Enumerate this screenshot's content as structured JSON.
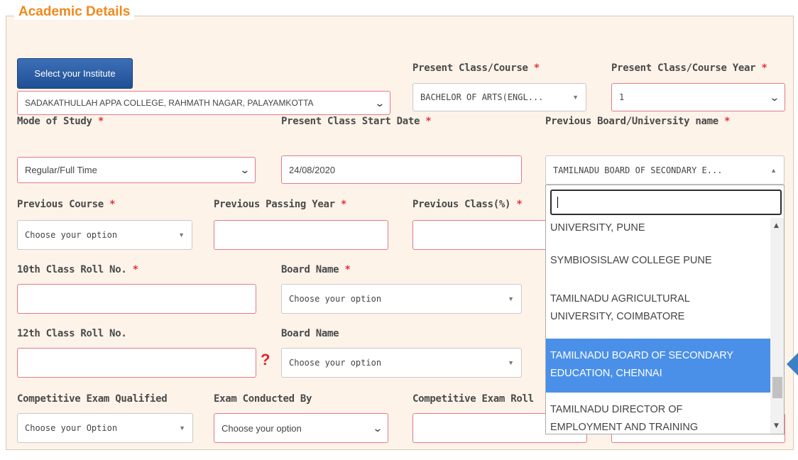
{
  "section": {
    "title": "Academic Details"
  },
  "institute": {
    "button_label": "Select your Institute",
    "value": "SADAKATHULLAH APPA COLLEGE, RAHMATH NAGAR, PALAYAMKOTTA"
  },
  "present_class": {
    "label": "Present Class/Course",
    "value": "BACHELOR OF ARTS(ENGL..."
  },
  "present_year": {
    "label": "Present Class/Course Year",
    "value": "1"
  },
  "mode_of_study": {
    "label": "Mode of Study",
    "value": "Regular/Full Time"
  },
  "start_date": {
    "label": "Present Class Start Date",
    "value": "24/08/2020"
  },
  "prev_board": {
    "label": "Previous Board/University name",
    "value": "TAMILNADU BOARD OF SECONDARY E..."
  },
  "prev_course": {
    "label": "Previous Course",
    "value": "Choose your option"
  },
  "prev_passing_year": {
    "label": "Previous Passing Year",
    "value": ""
  },
  "prev_class_pct": {
    "label": "Previous Class(%)",
    "value": ""
  },
  "roll_10": {
    "label": "10th Class Roll No.",
    "value": ""
  },
  "board_10": {
    "label": "Board Name",
    "value": "Choose your option"
  },
  "roll_12": {
    "label": "12th Class Roll No.",
    "value": ""
  },
  "board_12": {
    "label": "Board Name",
    "value": "Choose your option"
  },
  "competitive": {
    "label": "Competitive Exam Qualified",
    "value": "Choose your Option"
  },
  "exam_conducted": {
    "label": "Exam Conducted By",
    "value": "Choose your option"
  },
  "competitive_roll": {
    "label": "Competitive Exam Roll",
    "value": ""
  },
  "required_mark": "*",
  "question_mark": "?",
  "dropdown": {
    "search_value": "",
    "options": [
      {
        "lines": [
          "UNIVERSITY, PUNE"
        ],
        "selected": false
      },
      {
        "lines": [
          "SYMBIOSISLAW COLLEGE PUNE"
        ],
        "selected": false
      },
      {
        "lines": [
          "TAMILNADU AGRICULTURAL",
          "UNIVERSITY, COIMBATORE"
        ],
        "selected": false
      },
      {
        "lines": [
          "TAMILNADU BOARD OF SECONDARY",
          "EDUCATION, CHENNAI"
        ],
        "selected": true
      },
      {
        "lines": [
          "TAMILNADU DIRECTOR OF",
          "EMPLOYMENT AND TRAINING"
        ],
        "selected": false
      }
    ]
  },
  "colors": {
    "accent": "#f08a1c",
    "selected": "#4a90e8",
    "required": "#e5323c",
    "button": "#2a5ca3"
  }
}
